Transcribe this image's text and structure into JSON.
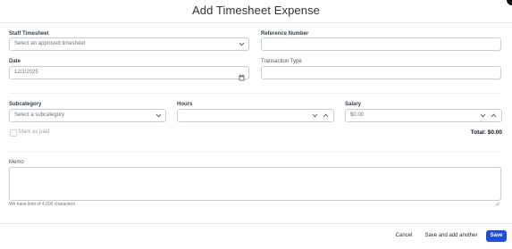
{
  "modal": {
    "title": "Add Timesheet Expense"
  },
  "form": {
    "staff_timesheet": {
      "label": "Staff Timesheet",
      "placeholder": "Select an approved timesheet"
    },
    "reference_number": {
      "label": "Reference Number",
      "value": ""
    },
    "date": {
      "label": "Date",
      "value": "12/1/2025"
    },
    "transaction_type": {
      "label": "Transaction Type",
      "value": ""
    },
    "subcategory": {
      "label": "Subcategory",
      "placeholder": "Select a subcategory"
    },
    "hours": {
      "label": "Hours",
      "value": ""
    },
    "salary": {
      "label": "Salary",
      "value": "$0.00"
    },
    "mark_as_paid": {
      "label": "Mark as paid",
      "checked": false
    },
    "total": {
      "text": "Total:  $0.00"
    },
    "memo": {
      "label": "Memo",
      "hint": "We have limit of 4,000 characters"
    }
  },
  "footer": {
    "cancel_label": "Cancel",
    "save_add_label": "Save and add another",
    "save_label": "Save"
  },
  "colors": {
    "primary": "#1d4ed8",
    "border": "#c7ccd3",
    "divider": "#e5e7eb"
  },
  "icons": [
    "chevron-down-icon",
    "chevron-up-icon",
    "calendar-icon",
    "resize-handle-icon"
  ]
}
